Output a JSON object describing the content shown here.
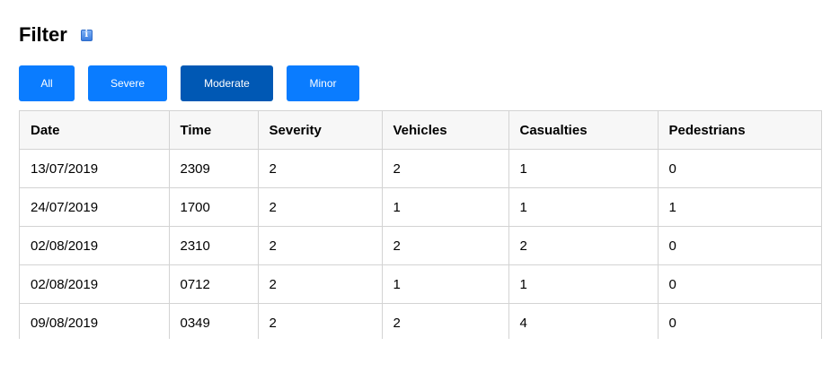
{
  "header": {
    "title": "Filter",
    "info_icon": "i"
  },
  "filters": {
    "buttons": [
      {
        "label": "All"
      },
      {
        "label": "Severe"
      },
      {
        "label": "Moderate"
      },
      {
        "label": "Minor"
      }
    ],
    "active": "Moderate",
    "colors": {
      "button": "#0a7cff",
      "active": "#0058b4"
    }
  },
  "table": {
    "columns": [
      "Date",
      "Time",
      "Severity",
      "Vehicles",
      "Casualties",
      "Pedestrians"
    ],
    "rows": [
      [
        "13/07/2019",
        "2309",
        "2",
        "2",
        "1",
        "0"
      ],
      [
        "24/07/2019",
        "1700",
        "2",
        "1",
        "1",
        "1"
      ],
      [
        "02/08/2019",
        "2310",
        "2",
        "2",
        "2",
        "0"
      ],
      [
        "02/08/2019",
        "0712",
        "2",
        "1",
        "1",
        "0"
      ],
      [
        "09/08/2019",
        "0349",
        "2",
        "2",
        "4",
        "0"
      ]
    ]
  }
}
